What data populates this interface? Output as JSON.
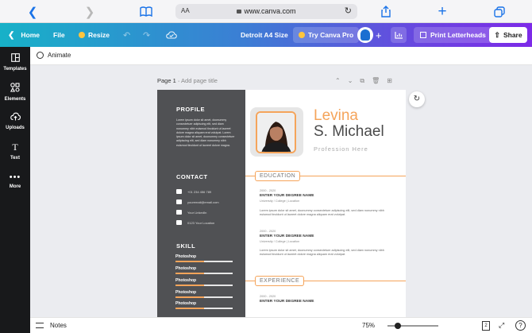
{
  "safari": {
    "aa": "AA",
    "url": "www.canva.com"
  },
  "header": {
    "home": "Home",
    "file": "File",
    "resize": "Resize",
    "title": "Detroit A4 Size",
    "try_pro": "Try Canva Pro",
    "print": "Print Letterheads",
    "share": "Share"
  },
  "sidebar": {
    "items": [
      {
        "label": "Templates"
      },
      {
        "label": "Elements"
      },
      {
        "label": "Uploads"
      },
      {
        "label": "Text"
      },
      {
        "label": "More"
      }
    ]
  },
  "toolbar": {
    "animate": "Animate"
  },
  "page": {
    "label": "Page 1",
    "add_title": "Add page title"
  },
  "resume": {
    "profile_heading": "PROFILE",
    "profile_text": "Lorem ipsum dolor sit amet, doonummy consectetuer adipiscing elit, sed diam nonummy nibh euismod tincidunt ut laoreet dolore magna aliquam erat volutpat. Lorem ipsum dolor sit amet, doonummy consectetuer adipiscing elit, sed diam nonummy nibh euismod tincidunt ut laoreet dolore magna.",
    "contact_heading": "CONTACT",
    "contacts": [
      "+01 234 456 789",
      "youremail@email.com",
      "Your LinkedIn",
      "0123 Your Location"
    ],
    "skill_heading": "SKILL",
    "skills": [
      {
        "name": "Photoshop",
        "level": 0.5
      },
      {
        "name": "Photoshop",
        "level": 0.5
      },
      {
        "name": "Photoshop",
        "level": 0.5
      },
      {
        "name": "Photoshop",
        "level": 0.5
      },
      {
        "name": "Photoshop",
        "level": 0.5
      }
    ],
    "first_name": "Levina",
    "last_name": "S. Michael",
    "profession": "Profession Here",
    "education_heading": "EDUCATION",
    "education": [
      {
        "date": "2000 - 2020",
        "degree": "ENTER YOUR DEGREE NAME",
        "school": "University / College | Location",
        "desc": "Lorem ipsum dolor sit amet, doonummy consectetuer adipiscing elit, sed diam nonummy nibh euismod tincidunt ut laoreet dolore magna aliquam erat volutpat."
      },
      {
        "date": "2000 - 2020",
        "degree": "ENTER YOUR DEGREE NAME",
        "school": "University / College | Location",
        "desc": "Lorem ipsum dolor sit amet, doonummy consectetuer adipiscing elit, sed diam nonummy nibh euismod tincidunt ut laoreet dolore magna aliquam erat volutpat."
      }
    ],
    "experience_heading": "EXPERIENCE",
    "experience": [
      {
        "date": "2000 - 2020",
        "title": "ENTER YOUR DEGREE NAME"
      }
    ]
  },
  "bottom": {
    "notes": "Notes",
    "zoom": "75%",
    "page_count": "2",
    "help": "?"
  },
  "colors": {
    "accent": "#f5a45a",
    "sidebar": "#505154",
    "header_start": "#17b1c8",
    "header_end": "#7d2ae8"
  }
}
